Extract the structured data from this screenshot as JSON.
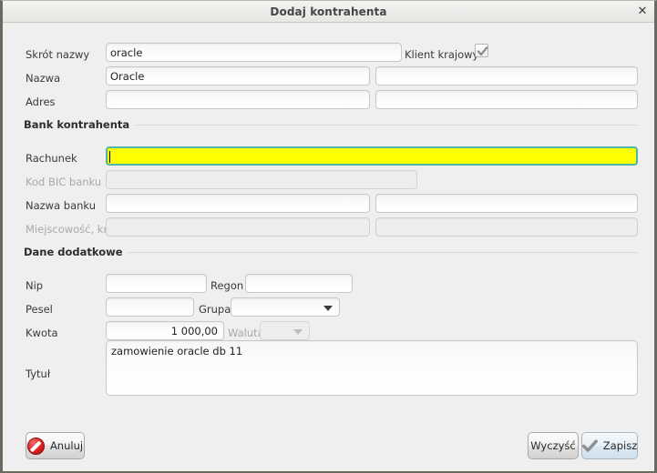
{
  "window": {
    "title": "Dodaj kontrahenta",
    "close_icon": "close-icon"
  },
  "form": {
    "fields": {
      "skrot_nazwy": {
        "label": "Skrót nazwy",
        "value": "oracle"
      },
      "klient_krajowy": {
        "label": "Klient krajowy",
        "checked": "checked",
        "check_icon": "check-icon"
      },
      "nazwa": {
        "label": "Nazwa",
        "value": "Oracle",
        "value2": ""
      },
      "adres": {
        "label": "Adres",
        "value": "",
        "value2": ""
      }
    },
    "sections": {
      "bank": {
        "title": "Bank kontrahenta"
      },
      "dane": {
        "title": "Dane dodatkowe"
      }
    },
    "bank": {
      "rachunek": {
        "label": "Rachunek",
        "value": ""
      },
      "kod_bic": {
        "label": "Kod BIC banku",
        "value": "",
        "state": "disabled"
      },
      "nazwa_banku": {
        "label": "Nazwa banku",
        "value": "",
        "value2": ""
      },
      "miejscowosc": {
        "label": "Miejscowość, kraj",
        "value": "",
        "value2": "",
        "state": "disabled"
      }
    },
    "dane": {
      "nip": {
        "label": "Nip",
        "value": ""
      },
      "regon": {
        "label": "Regon",
        "value": ""
      },
      "pesel": {
        "label": "Pesel",
        "value": ""
      },
      "grupa": {
        "label": "Grupa",
        "value": "",
        "dropdown_icon": "chevron-down-icon"
      },
      "kwota": {
        "label": "Kwota",
        "value": "1 000,00"
      },
      "waluta": {
        "label": "Waluta",
        "value": "",
        "state": "disabled",
        "dropdown_icon": "chevron-down-icon"
      },
      "tytul": {
        "label": "Tytuł",
        "value": "zamowienie oracle db 11"
      }
    }
  },
  "footer": {
    "cancel": {
      "label": "Anuluj",
      "icon": "cancel-icon"
    },
    "clear": {
      "label": "Wyczyść"
    },
    "save": {
      "label": "Zapisz",
      "icon": "check-icon"
    }
  },
  "colors": {
    "focus_field_bg": "#ffff00",
    "focus_field_border": "#4fb3a5",
    "cancel_icon": "#e02020",
    "window_bg": "#efefef",
    "accent_button": "#dce9f2"
  }
}
